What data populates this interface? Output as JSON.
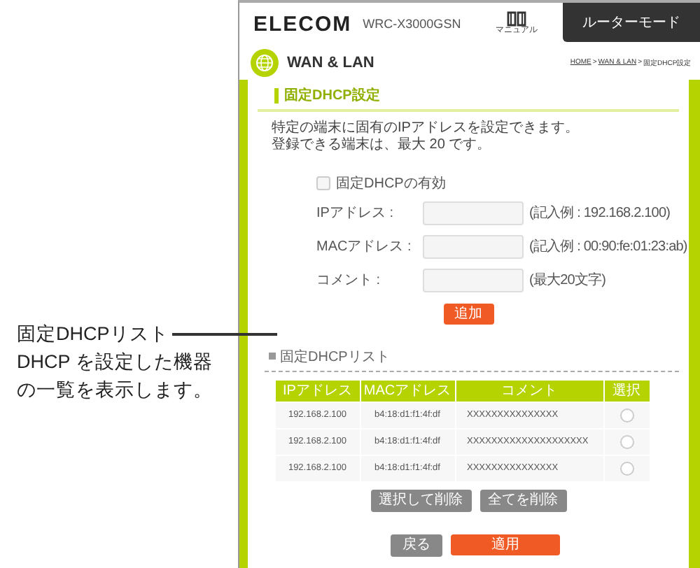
{
  "callout": {
    "title": "固定DHCPリスト",
    "lines": [
      "DHCP を設定した機器",
      "の一覧を表示します。"
    ]
  },
  "header": {
    "logo": "ELECOM",
    "model": "WRC-X3000GSN",
    "manual_label": "マニュアル",
    "mode_button": "ルーターモード"
  },
  "page": {
    "title": "WAN & LAN",
    "breadcrumb": [
      "HOME",
      "WAN & LAN",
      "固定DHCP設定"
    ],
    "separator": ">"
  },
  "section": {
    "title": "固定DHCP設定",
    "description": [
      "特定の端末に固有のIPアドレスを設定できます。",
      "登録できる端末は、最大 20 です。"
    ]
  },
  "enable": {
    "label": "固定DHCPの有効",
    "checked": false
  },
  "fields": [
    {
      "label": "IPアドレス :",
      "hint": "(記入例 : 192.168.2.100)"
    },
    {
      "label": "MACアドレス :",
      "hint": "(記入例 : 00:90:fe:01:23:ab)"
    },
    {
      "label": "コメント :",
      "hint": "(最大20文字)"
    }
  ],
  "add_button": "追加",
  "list": {
    "title": "固定DHCPリスト",
    "columns": [
      "IPアドレス",
      "MACアドレス",
      "コメント",
      "選択"
    ],
    "rows": [
      {
        "ip": "192.168.2.100",
        "mac": "b4:18:d1:f1:4f:df",
        "comment": "XXXXXXXXXXXXXXX",
        "selected": false
      },
      {
        "ip": "192.168.2.100",
        "mac": "b4:18:d1:f1:4f:df",
        "comment": "XXXXXXXXXXXXXXXXXXXX",
        "selected": false
      },
      {
        "ip": "192.168.2.100",
        "mac": "b4:18:d1:f1:4f:df",
        "comment": "XXXXXXXXXXXXXXX",
        "selected": false
      }
    ]
  },
  "list_buttons": [
    "選択して削除",
    "全てを削除"
  ],
  "footer_buttons": [
    {
      "label": "戻る",
      "kind": "secondary"
    },
    {
      "label": "適用",
      "kind": "primary"
    }
  ]
}
